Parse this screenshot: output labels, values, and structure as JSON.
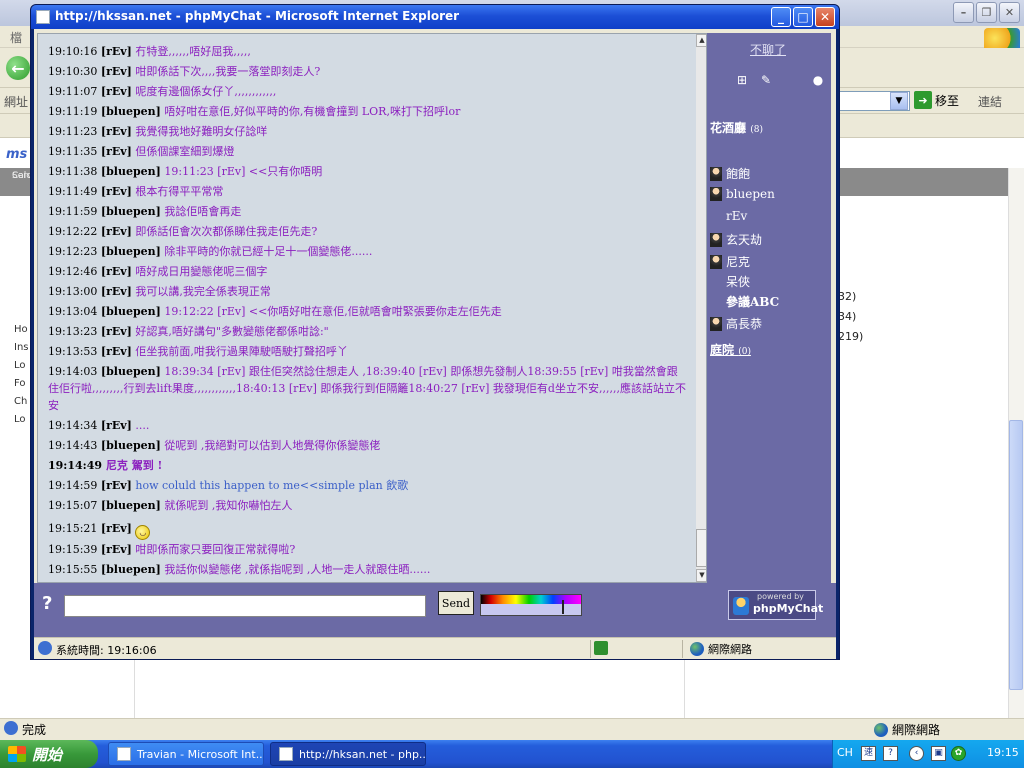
{
  "background_window": {
    "menu_first": "檔",
    "address_label": "網址",
    "go_label": "移至",
    "links_label": "連結",
    "brand": "ms",
    "gray_strip_lines": [
      "Calc",
      "Serv"
    ],
    "side_items": [
      "Ho",
      "Ins",
      "Lo",
      "Fo",
      "Ch",
      "Lo"
    ],
    "side_numbers": [
      "32)",
      "34)",
      "219)"
    ],
    "status_text": "完成",
    "zone_text": "網際網路"
  },
  "chat_window": {
    "title": "http://hkssan.net - phpMyChat - Microsoft Internet Explorer",
    "status_time": "系統時間: 19:16:06",
    "zone_text": "網際網路"
  },
  "messages": [
    {
      "time": "19:10:16",
      "nick": "[rEv]",
      "text": "冇特登,,,,,,唔好屈我,,,,,"
    },
    {
      "time": "19:10:30",
      "nick": "[rEv]",
      "text": "咁即係話下次,,,,我要一落堂即刻走人?"
    },
    {
      "time": "19:11:07",
      "nick": "[rEv]",
      "text": "呢度有邊個係女仔丫,,,,,,,,,,,,"
    },
    {
      "time": "19:11:19",
      "nick": "[bluepen]",
      "text": "唔好咁在意佢,好似平時的你,有機會撞到 LOR,咪打下招呼lor"
    },
    {
      "time": "19:11:23",
      "nick": "[rEv]",
      "text": "我覺得我地好難明女仔諗咩"
    },
    {
      "time": "19:11:35",
      "nick": "[rEv]",
      "text": "但係個課室細到爆燈"
    },
    {
      "time": "19:11:38",
      "nick": "[bluepen]",
      "text": "19:11:23 [rEv] <<只有你唔明"
    },
    {
      "time": "19:11:49",
      "nick": "[rEv]",
      "text": "根本冇得平平常常"
    },
    {
      "time": "19:11:59",
      "nick": "[bluepen]",
      "text": "我諗佢唔會再走"
    },
    {
      "time": "19:12:22",
      "nick": "[rEv]",
      "text": "即係話佢會次次都係睇住我走佢先走?"
    },
    {
      "time": "19:12:23",
      "nick": "[bluepen]",
      "text": "除非平時的你就已經十足十一個變態佬......"
    },
    {
      "time": "19:12:46",
      "nick": "[rEv]",
      "text": "唔好成日用變態佬呢三個字"
    },
    {
      "time": "19:13:00",
      "nick": "[rEv]",
      "text": "我可以講,我完全係表現正常"
    },
    {
      "time": "19:13:04",
      "nick": "[bluepen]",
      "text": "19:12:22 [rEv] <<你唔好咁在意佢,佢就唔會咁緊張要你走左佢先走"
    },
    {
      "time": "19:13:23",
      "nick": "[rEv]",
      "text": "好認真,唔好講句\"多數變態佬都係咁諗:\""
    },
    {
      "time": "19:13:53",
      "nick": "[rEv]",
      "text": "佢坐我前面,咁我行過果陣駛唔駛打聲招呼丫"
    },
    {
      "time": "19:14:03",
      "nick": "[bluepen]",
      "text": "18:39:34 [rEv] 跟住佢突然諗住想走人 ,18:39:40 [rEv] 即係想先發制人18:39:55 [rEv] 咁我當然會跟住佢行啦,,,,,,,,,行到去lift果度,,,,,,,,,,,,18:40:13 [rEv] 即係我行到佢隔籬18:40:27 [rEv] 我發現佢有d坐立不安,,,,,,應該話站立不安"
    },
    {
      "time": "19:14:34",
      "nick": "[rEv]",
      "text": "...."
    },
    {
      "time": "19:14:43",
      "nick": "[bluepen]",
      "text": "從呢到 ,我絕對可以估到人地覺得你係變態佬"
    },
    {
      "time": "19:14:49",
      "nick": "",
      "text": "尼克 駕到 !"
    },
    {
      "time": "19:14:59",
      "nick": "[rEv]",
      "text": "how coluld this happen to me<<simple plan 飲歌"
    },
    {
      "time": "19:15:07",
      "nick": "[bluepen]",
      "text": "就係呢到 ,我知你嚇怕左人"
    },
    {
      "time": "19:15:21",
      "nick": "[rEv]",
      "text": ""
    },
    {
      "time": "19:15:39",
      "nick": "[rEv]",
      "text": "咁即係而家只要回復正常就得啦?"
    },
    {
      "time": "19:15:55",
      "nick": "[bluepen]",
      "text": "我話你似變態佬 ,就係指呢到 ,人地一走人就跟住晒......"
    }
  ],
  "users_panel": {
    "logout_label": "不聊了",
    "room1_name": "花酒廳",
    "room1_count": "(8)",
    "users": [
      {
        "name": "飽飽",
        "icon": true,
        "self": false
      },
      {
        "name": "bluepen",
        "icon": true,
        "self": false
      },
      {
        "name": "rEv",
        "icon": false,
        "self": false
      },
      {
        "name": "玄天劫",
        "icon": true,
        "self": false
      },
      {
        "name": "尼克",
        "icon": true,
        "self": false
      },
      {
        "name": "呆俠",
        "icon": false,
        "self": false
      },
      {
        "name": "參議ABC",
        "icon": false,
        "self": true
      },
      {
        "name": "高長恭",
        "icon": true,
        "self": false
      }
    ],
    "room2_name": "庭院",
    "room2_count": "(0)"
  },
  "input_bar": {
    "help_glyph": "?",
    "send_label": "Send",
    "powered_small": "powered by",
    "powered_logo": "phpMyChat"
  },
  "taskbar": {
    "start_label": "開始",
    "task1": "Travian - Microsoft Int...",
    "task2": "http://hksan.net - php...",
    "lang": "CH",
    "clock": "19:15"
  },
  "icons": {
    "back": "back-arrow-icon",
    "help": "help-icon",
    "user": "user-avatar-icon",
    "globe": "globe-icon",
    "smiley": "smiley-icon"
  }
}
